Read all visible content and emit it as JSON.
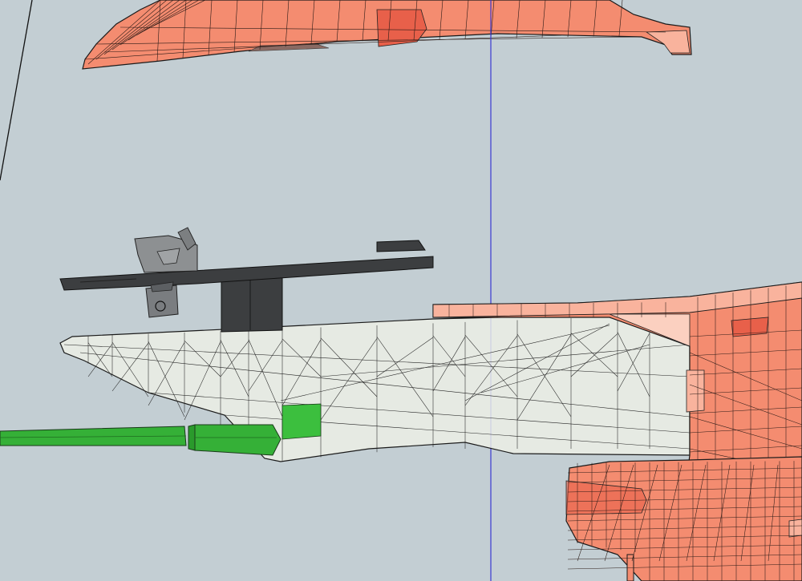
{
  "viewport": {
    "background": "#c3ced3",
    "edge_color": "#1a1a1a",
    "axis_color": "#3a3ad0",
    "palette": {
      "salmon": "#f48c70",
      "salmon_light": "#f9b39d",
      "salmon_dark": "#e8604a",
      "dark_part": "#3c3e40",
      "ghost": "#eef0e6",
      "green": "#35b037"
    },
    "meshes": [
      {
        "name": "upper-canopy-mesh",
        "color": "salmon"
      },
      {
        "name": "top-plate-mesh",
        "color": "dark_part"
      },
      {
        "name": "bracket-mesh",
        "color": "dark_part"
      },
      {
        "name": "ghost-hull-mesh",
        "color": "ghost"
      },
      {
        "name": "green-rod-mesh",
        "color": "green"
      },
      {
        "name": "right-body-mesh",
        "color": "salmon"
      },
      {
        "name": "lower-pod-mesh",
        "color": "salmon"
      }
    ]
  }
}
